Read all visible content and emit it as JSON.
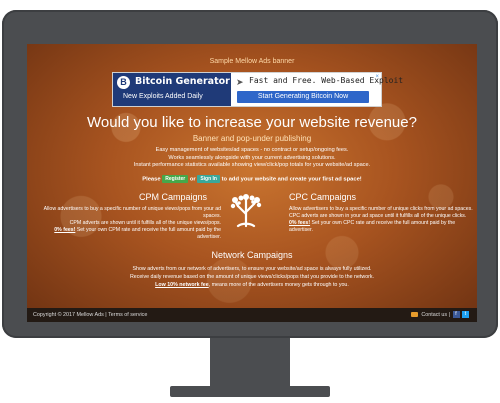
{
  "banner": {
    "caption": "Sample Mellow Ads banner",
    "ad": {
      "logo_letter": "B",
      "title": "Bitcoin Generator",
      "subtitle": "New Exploits Added Daily",
      "tagline": "Fast and Free. Web-Based Exploit",
      "cta": "Start Generating Bitcoin Now",
      "close_icon": "×"
    }
  },
  "hero": {
    "headline": "Would you like to increase your website revenue?",
    "subhead": "Banner and pop-under publishing",
    "features": [
      "Easy management of websites/ad spaces - no contract or setup/ongoing fees.",
      "Works seamlessly alongside with your current advertising solutions.",
      "Instant performance statistics available showing view/click/pop totals for your website/ad space."
    ],
    "cta_prefix": "Please",
    "register_label": "Register",
    "cta_or": "or",
    "signin_label": "Sign In",
    "cta_suffix": "to add your website and create your first ad space!"
  },
  "cpm": {
    "title": "CPM Campaigns",
    "p1": "Allow advertisers to buy a specific number of unique views/pops from your ad spaces.",
    "p2": "CPM adverts are shown until it fulfills all of the unique views/pops.",
    "p3_bold": "0% fees!",
    "p3": "Set your own CPM rate and receive the full amount paid by the advertiser."
  },
  "cpc": {
    "title": "CPC Campaigns",
    "p1": "Allow advertisers to buy a specific number of unique clicks from your ad spaces.",
    "p2": "CPC adverts are shown in your ad space until it fulfills all of the unique clicks.",
    "p3_bold": "0% fees!",
    "p3": "Set your own CPC rate and receive the full amount paid by the advertiser."
  },
  "network": {
    "title": "Network Campaigns",
    "line1": "Show adverts from our network of advertisers, to ensure your website/ad space is always fully utilized.",
    "line2": "Receive daily revenue based on the amount of unique views/clicks/pops that you provide to the network.",
    "line3_bold": "Low 10% network fee",
    "line3": ", means more of the advertisers money gets through to you."
  },
  "footer": {
    "copyright": "Copyright © 2017 Mellow Ads",
    "separator": "|",
    "terms": "Terms of service",
    "contact": "Contact us",
    "facebook": "f",
    "twitter": "t"
  }
}
